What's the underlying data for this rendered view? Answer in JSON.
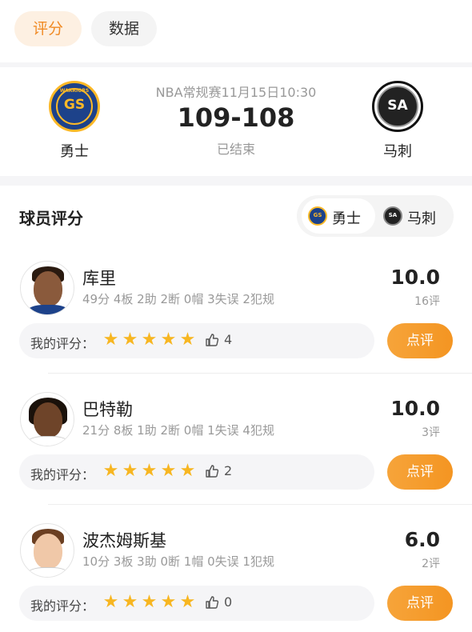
{
  "tabs": [
    {
      "label": "评分",
      "active": true
    },
    {
      "label": "数据",
      "active": false
    }
  ],
  "match": {
    "info": "NBA常规赛11月15日10:30",
    "score": "109-108",
    "status": "已结束",
    "home": {
      "name": "勇士",
      "logo_text": "GS",
      "logo_sub": "WARRIORS"
    },
    "away": {
      "name": "马刺",
      "logo_text": "SA"
    }
  },
  "section": {
    "title": "球员评分",
    "switch": [
      {
        "label": "勇士",
        "logo_text": "GS",
        "active": true
      },
      {
        "label": "马刺",
        "logo_text": "SA",
        "active": false
      }
    ]
  },
  "players": [
    {
      "name": "库里",
      "stats": "49分 4板 2助 2断 0帽 3失误 2犯规",
      "score": "10.0",
      "count": "16评",
      "rate_label": "我的评分：",
      "stars": 5,
      "likes": "4",
      "review": "点评"
    },
    {
      "name": "巴特勒",
      "stats": "21分 8板 1助 2断 0帽 1失误 4犯规",
      "score": "10.0",
      "count": "3评",
      "rate_label": "我的评分：",
      "stars": 5,
      "likes": "2",
      "review": "点评"
    },
    {
      "name": "波杰姆斯基",
      "stats": "10分 3板 3助 0断 1帽 0失误 1犯规",
      "score": "6.0",
      "count": "2评",
      "rate_label": "我的评分：",
      "stars": 5,
      "likes": "0",
      "review": "点评"
    }
  ],
  "colors": {
    "accent": "#f49522",
    "star": "#f7b621",
    "warriors_blue": "#1d428a",
    "warriors_gold": "#fdb927"
  }
}
